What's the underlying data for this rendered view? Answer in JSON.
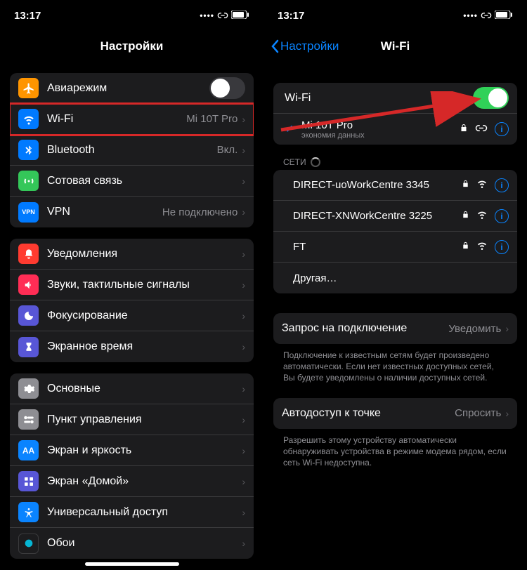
{
  "status": {
    "time": "13:17"
  },
  "left": {
    "title": "Настройки",
    "groups": [
      [
        {
          "icon": "airplane-icon",
          "bg": "bg-orange",
          "label": "Авиарежим",
          "toggle": false
        },
        {
          "icon": "wifi-icon",
          "bg": "bg-blue",
          "label": "Wi-Fi",
          "value": "Mi 10T Pro",
          "highlight": true
        },
        {
          "icon": "bluetooth-icon",
          "bg": "bg-blue",
          "label": "Bluetooth",
          "value": "Вкл."
        },
        {
          "icon": "cellular-icon",
          "bg": "bg-green",
          "label": "Сотовая связь"
        },
        {
          "icon": "vpn-icon",
          "bg": "bg-vpn",
          "label": "VPN",
          "value": "Не подключено"
        }
      ],
      [
        {
          "icon": "bell-icon",
          "bg": "bg-red",
          "label": "Уведомления"
        },
        {
          "icon": "speaker-icon",
          "bg": "bg-redd",
          "label": "Звуки, тактильные сигналы"
        },
        {
          "icon": "moon-icon",
          "bg": "bg-indigo",
          "label": "Фокусирование"
        },
        {
          "icon": "hourglass-icon",
          "bg": "bg-indigo",
          "label": "Экранное время"
        }
      ],
      [
        {
          "icon": "gear-icon",
          "bg": "bg-gray",
          "label": "Основные"
        },
        {
          "icon": "switches-icon",
          "bg": "bg-gray",
          "label": "Пункт управления"
        },
        {
          "icon": "aa-icon",
          "bg": "bg-bblue",
          "label": "Экран и яркость"
        },
        {
          "icon": "grid-icon",
          "bg": "bg-indigo",
          "label": "Экран «Домой»"
        },
        {
          "icon": "accessibility-icon",
          "bg": "bg-bblue",
          "label": "Универсальный доступ"
        },
        {
          "icon": "wallpaper-icon",
          "bg": "bg-black",
          "label": "Обои"
        }
      ]
    ]
  },
  "right": {
    "back": "Настройки",
    "title": "Wi-Fi",
    "wifi_row_label": "Wi-Fi",
    "wifi_toggle": true,
    "connected": {
      "name": "Mi 10T Pro",
      "sub": "экономия данных"
    },
    "section_networks": "СЕТИ",
    "networks": [
      {
        "name": "DIRECT-uoWorkCentre 3345",
        "lock": true
      },
      {
        "name": "DIRECT-XNWorkCentre 3225",
        "lock": true
      },
      {
        "name": "FT",
        "lock": true
      }
    ],
    "other": "Другая…",
    "ask_row": {
      "label": "Запрос на подключение",
      "value": "Уведомить"
    },
    "ask_footer": "Подключение к известным сетям будет произведено автоматически. Если нет известных доступных сетей, Вы будете уведомлены о наличии доступных сетей.",
    "auto_row": {
      "label": "Автодоступ к точке",
      "value": "Спросить"
    },
    "auto_footer": "Разрешить этому устройству автоматически обнаруживать устройства в режиме модема рядом, если сеть Wi-Fi недоступна."
  }
}
